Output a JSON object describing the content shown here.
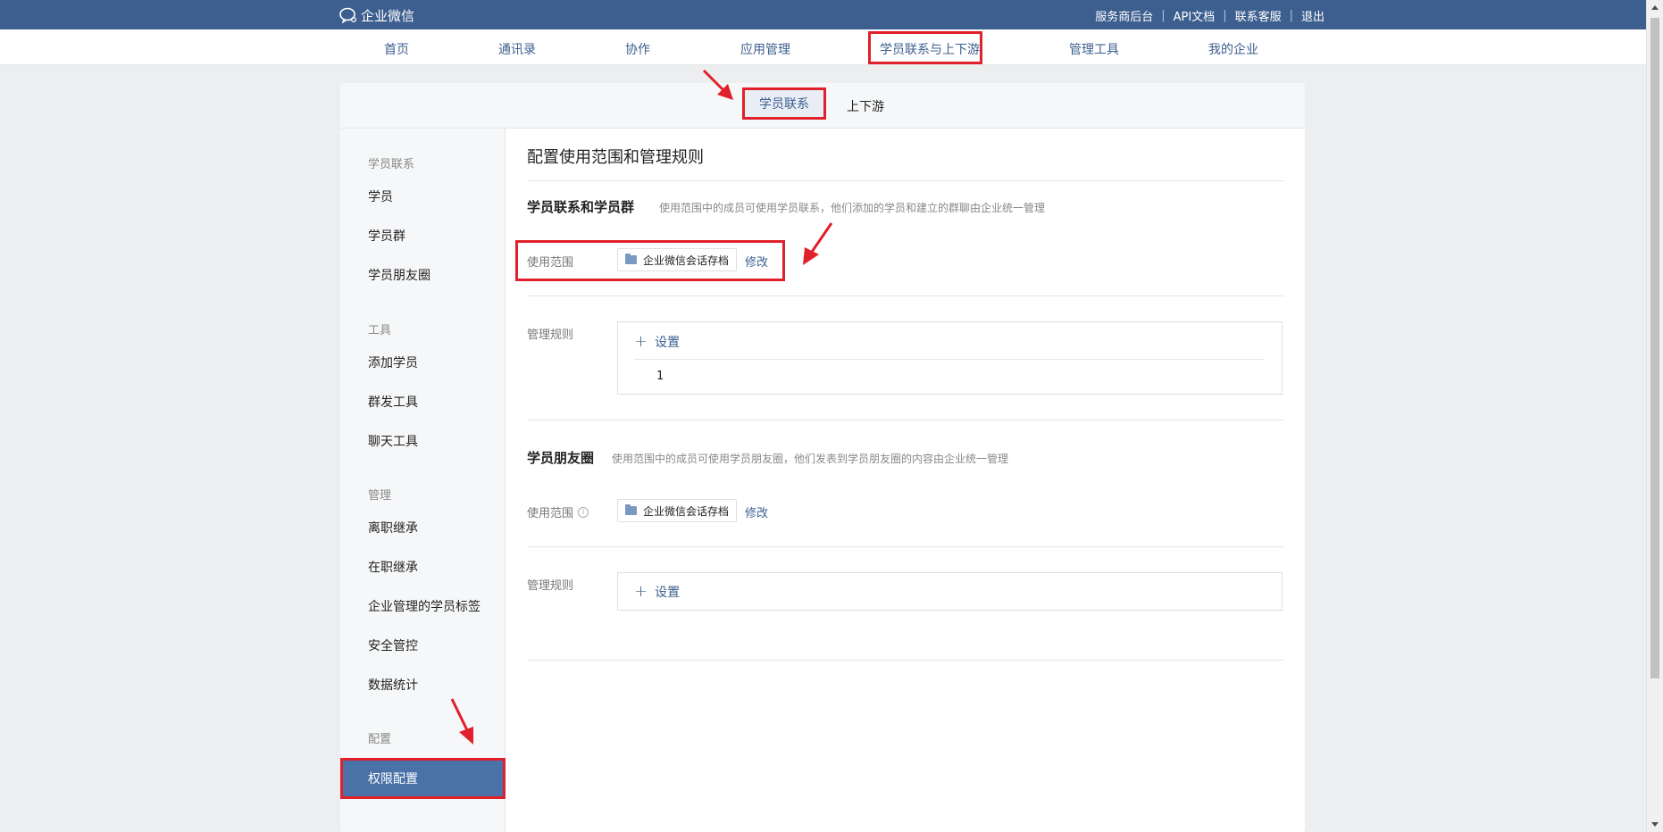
{
  "topbar": {
    "brand": "企业微信",
    "links": [
      "服务商后台",
      "API文档",
      "联系客服",
      "退出"
    ]
  },
  "nav": {
    "items": [
      "首页",
      "通讯录",
      "协作",
      "应用管理",
      "学员联系与上下游",
      "管理工具",
      "我的企业"
    ],
    "active": "学员联系与上下游"
  },
  "subtabs": {
    "active": "学员联系",
    "other": "上下游"
  },
  "sidebar": {
    "groups": [
      {
        "title": "学员联系",
        "items": [
          "学员",
          "学员群",
          "学员朋友圈"
        ]
      },
      {
        "title": "工具",
        "items": [
          "添加学员",
          "群发工具",
          "聊天工具"
        ]
      },
      {
        "title": "管理",
        "items": [
          "离职继承",
          "在职继承",
          "企业管理的学员标签",
          "安全管控",
          "数据统计"
        ]
      },
      {
        "title": "配置",
        "items": [
          "权限配置"
        ]
      }
    ],
    "active": "权限配置"
  },
  "main": {
    "title": "配置使用范围和管理规则",
    "section1": {
      "title": "学员联系和学员群",
      "desc": "使用范围中的成员可使用学员联系，他们添加的学员和建立的群聊由企业统一管理",
      "scope_label": "使用范围",
      "scope_value": "企业微信会话存档",
      "modify": "修改",
      "rules_label": "管理规则",
      "set": "设置",
      "rule_item": "1"
    },
    "section2": {
      "title": "学员朋友圈",
      "desc": "使用范围中的成员可使用学员朋友圈，他们发表到学员朋友圈的内容由企业统一管理",
      "scope_label": "使用范围",
      "scope_value": "企业微信会话存档",
      "modify": "修改",
      "rules_label": "管理规则",
      "set": "设置"
    }
  },
  "colors": {
    "brand": "#3d5f8f",
    "highlight": "#e0202a",
    "active_bg": "#4a72a8"
  }
}
